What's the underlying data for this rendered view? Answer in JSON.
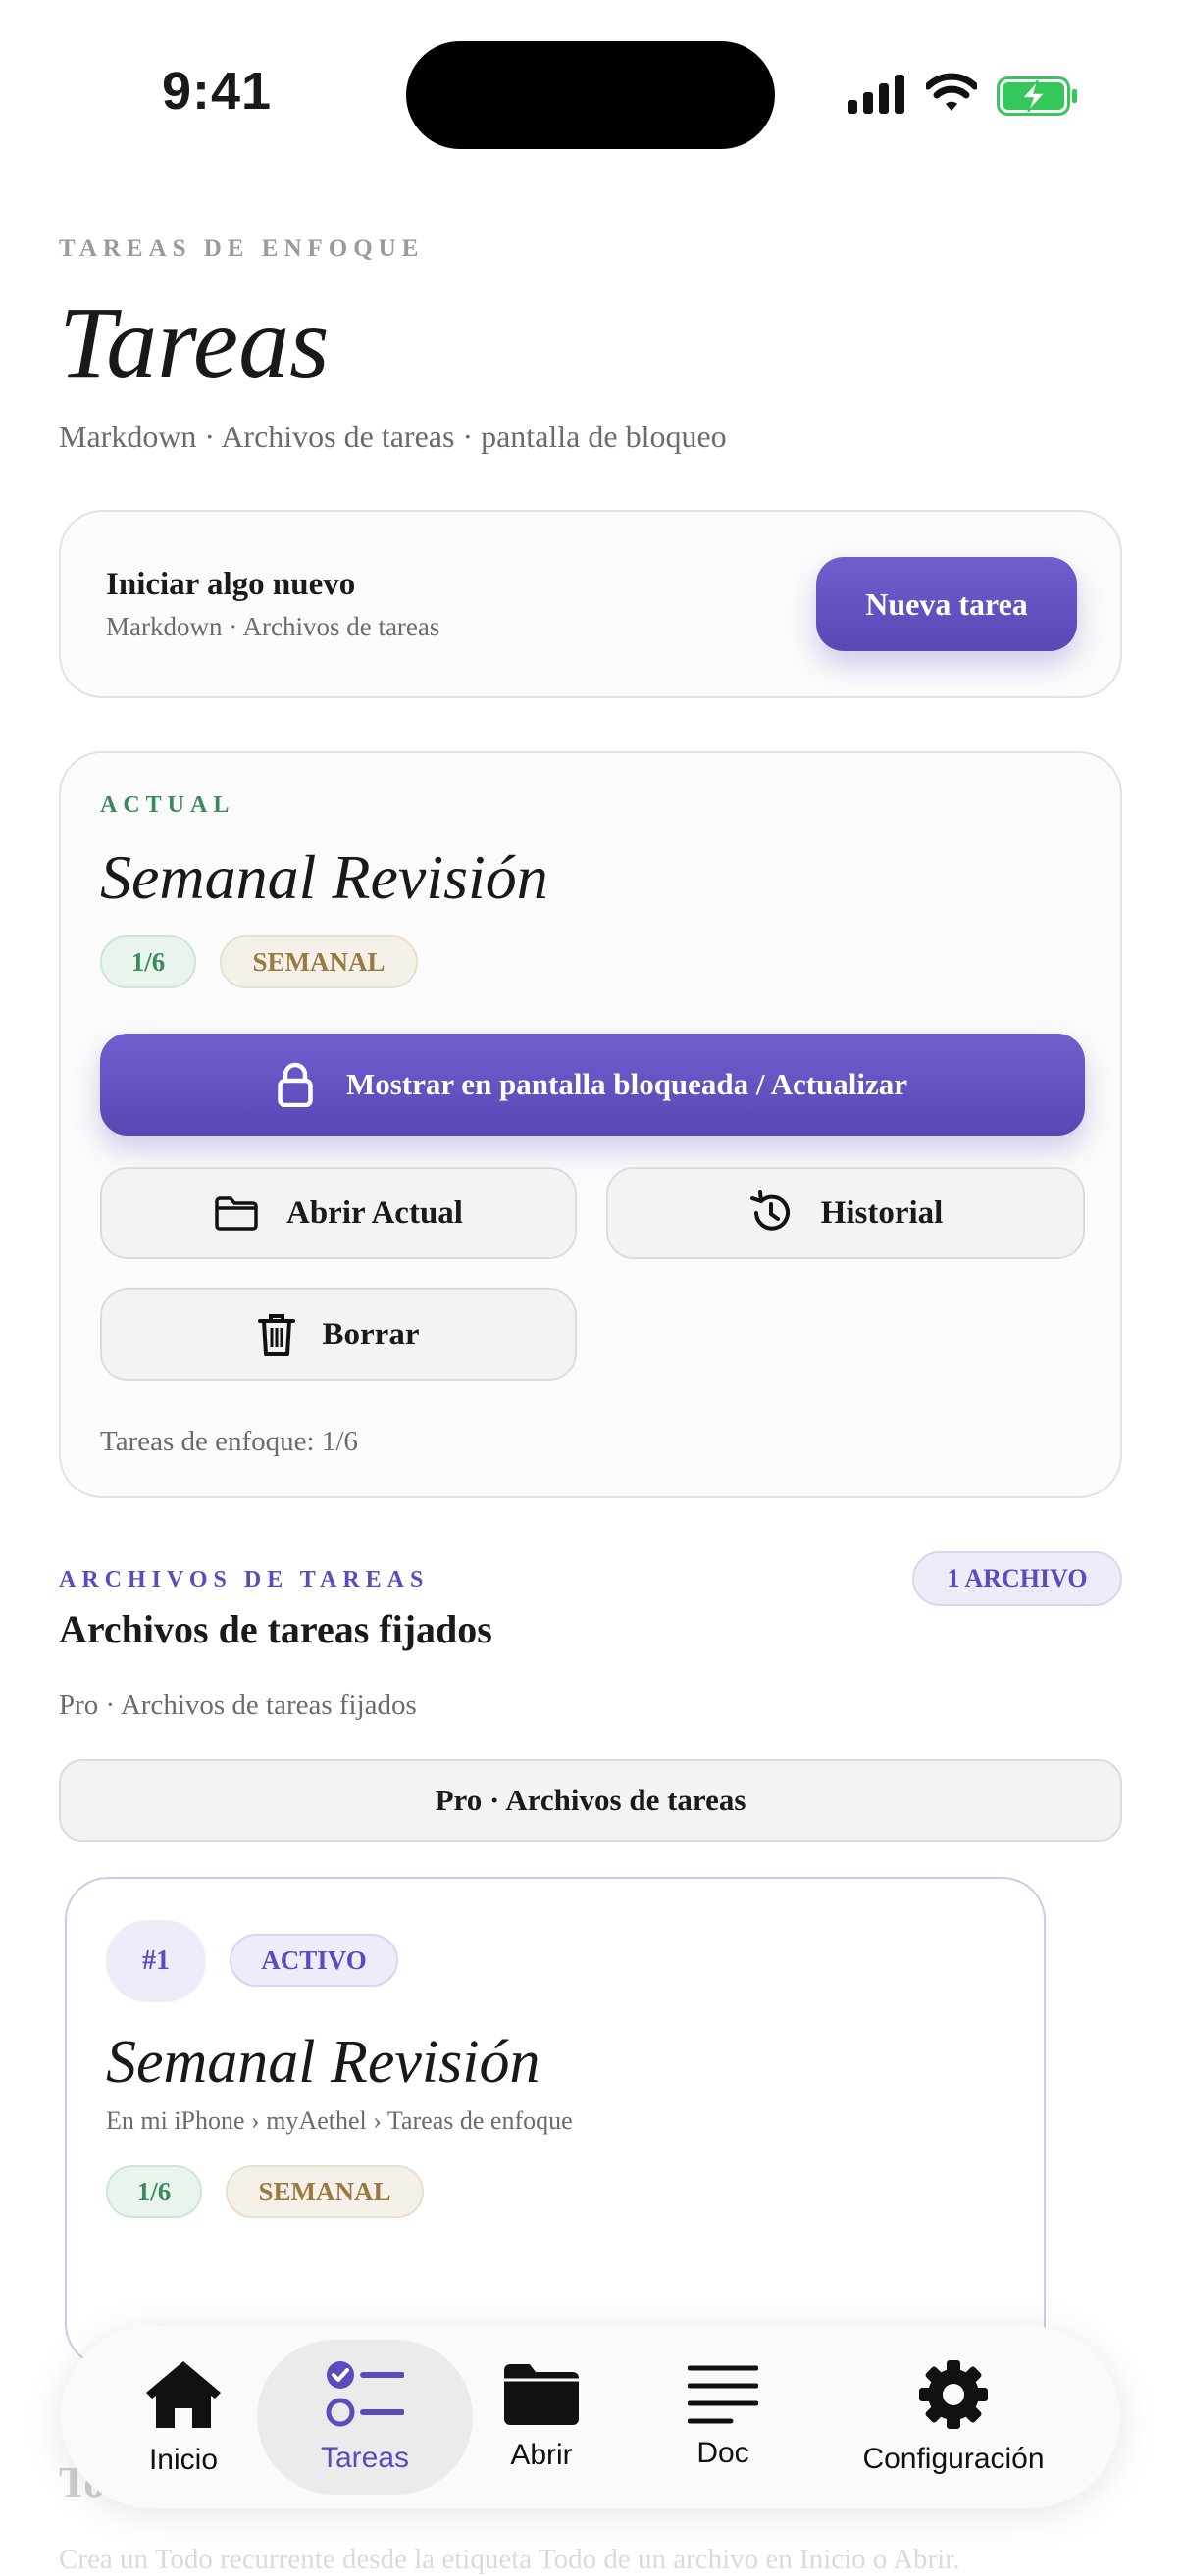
{
  "status_bar": {
    "time": "9:41"
  },
  "header": {
    "eyebrow": "TAREAS DE ENFOQUE",
    "title": "Tareas",
    "subtitle": "Markdown · Archivos de tareas · pantalla de bloqueo"
  },
  "new_card": {
    "title": "Iniciar algo nuevo",
    "subtitle": "Markdown · Archivos de tareas",
    "button": "Nueva tarea"
  },
  "current": {
    "eyebrow": "ACTUAL",
    "title": "Semanal Revisión",
    "progress_badge": "1/6",
    "frequency_badge": "SEMANAL",
    "lock_button": "Mostrar en pantalla bloqueada / Actualizar",
    "open_button": "Abrir Actual",
    "history_button": "Historial",
    "delete_button": "Borrar",
    "footer": "Tareas de enfoque: 1/6"
  },
  "files": {
    "eyebrow": "ARCHIVOS DE TAREAS",
    "count_badge": "1 ARCHIVO",
    "title": "Archivos de tareas fijados",
    "subtitle": "Pro · Archivos de tareas fijados",
    "pro_button": "Pro · Archivos de tareas",
    "items": [
      {
        "index": "#1",
        "state": "ACTIVO",
        "title": "Semanal Revisión",
        "path": "En mi iPhone › myAethel › Tareas de enfoque",
        "progress": "1/6",
        "frequency": "SEMANAL"
      }
    ]
  },
  "below": {
    "title": "Todo",
    "hint": "Crea un Todo recurrente desde la etiqueta Todo de un archivo en Inicio o Abrir."
  },
  "tabbar": {
    "tabs": [
      {
        "label": "Inicio",
        "icon": "house-icon"
      },
      {
        "label": "Tareas",
        "icon": "checklist-icon",
        "active": true
      },
      {
        "label": "Abrir",
        "icon": "folder-icon"
      },
      {
        "label": "Doc",
        "icon": "lines-icon"
      },
      {
        "label": "Configuración",
        "icon": "gear-icon"
      }
    ]
  },
  "colors": {
    "accent": "#5b4bbf",
    "green": "#3d8a58",
    "tan": "#9b7a42",
    "battery": "#34c759"
  }
}
